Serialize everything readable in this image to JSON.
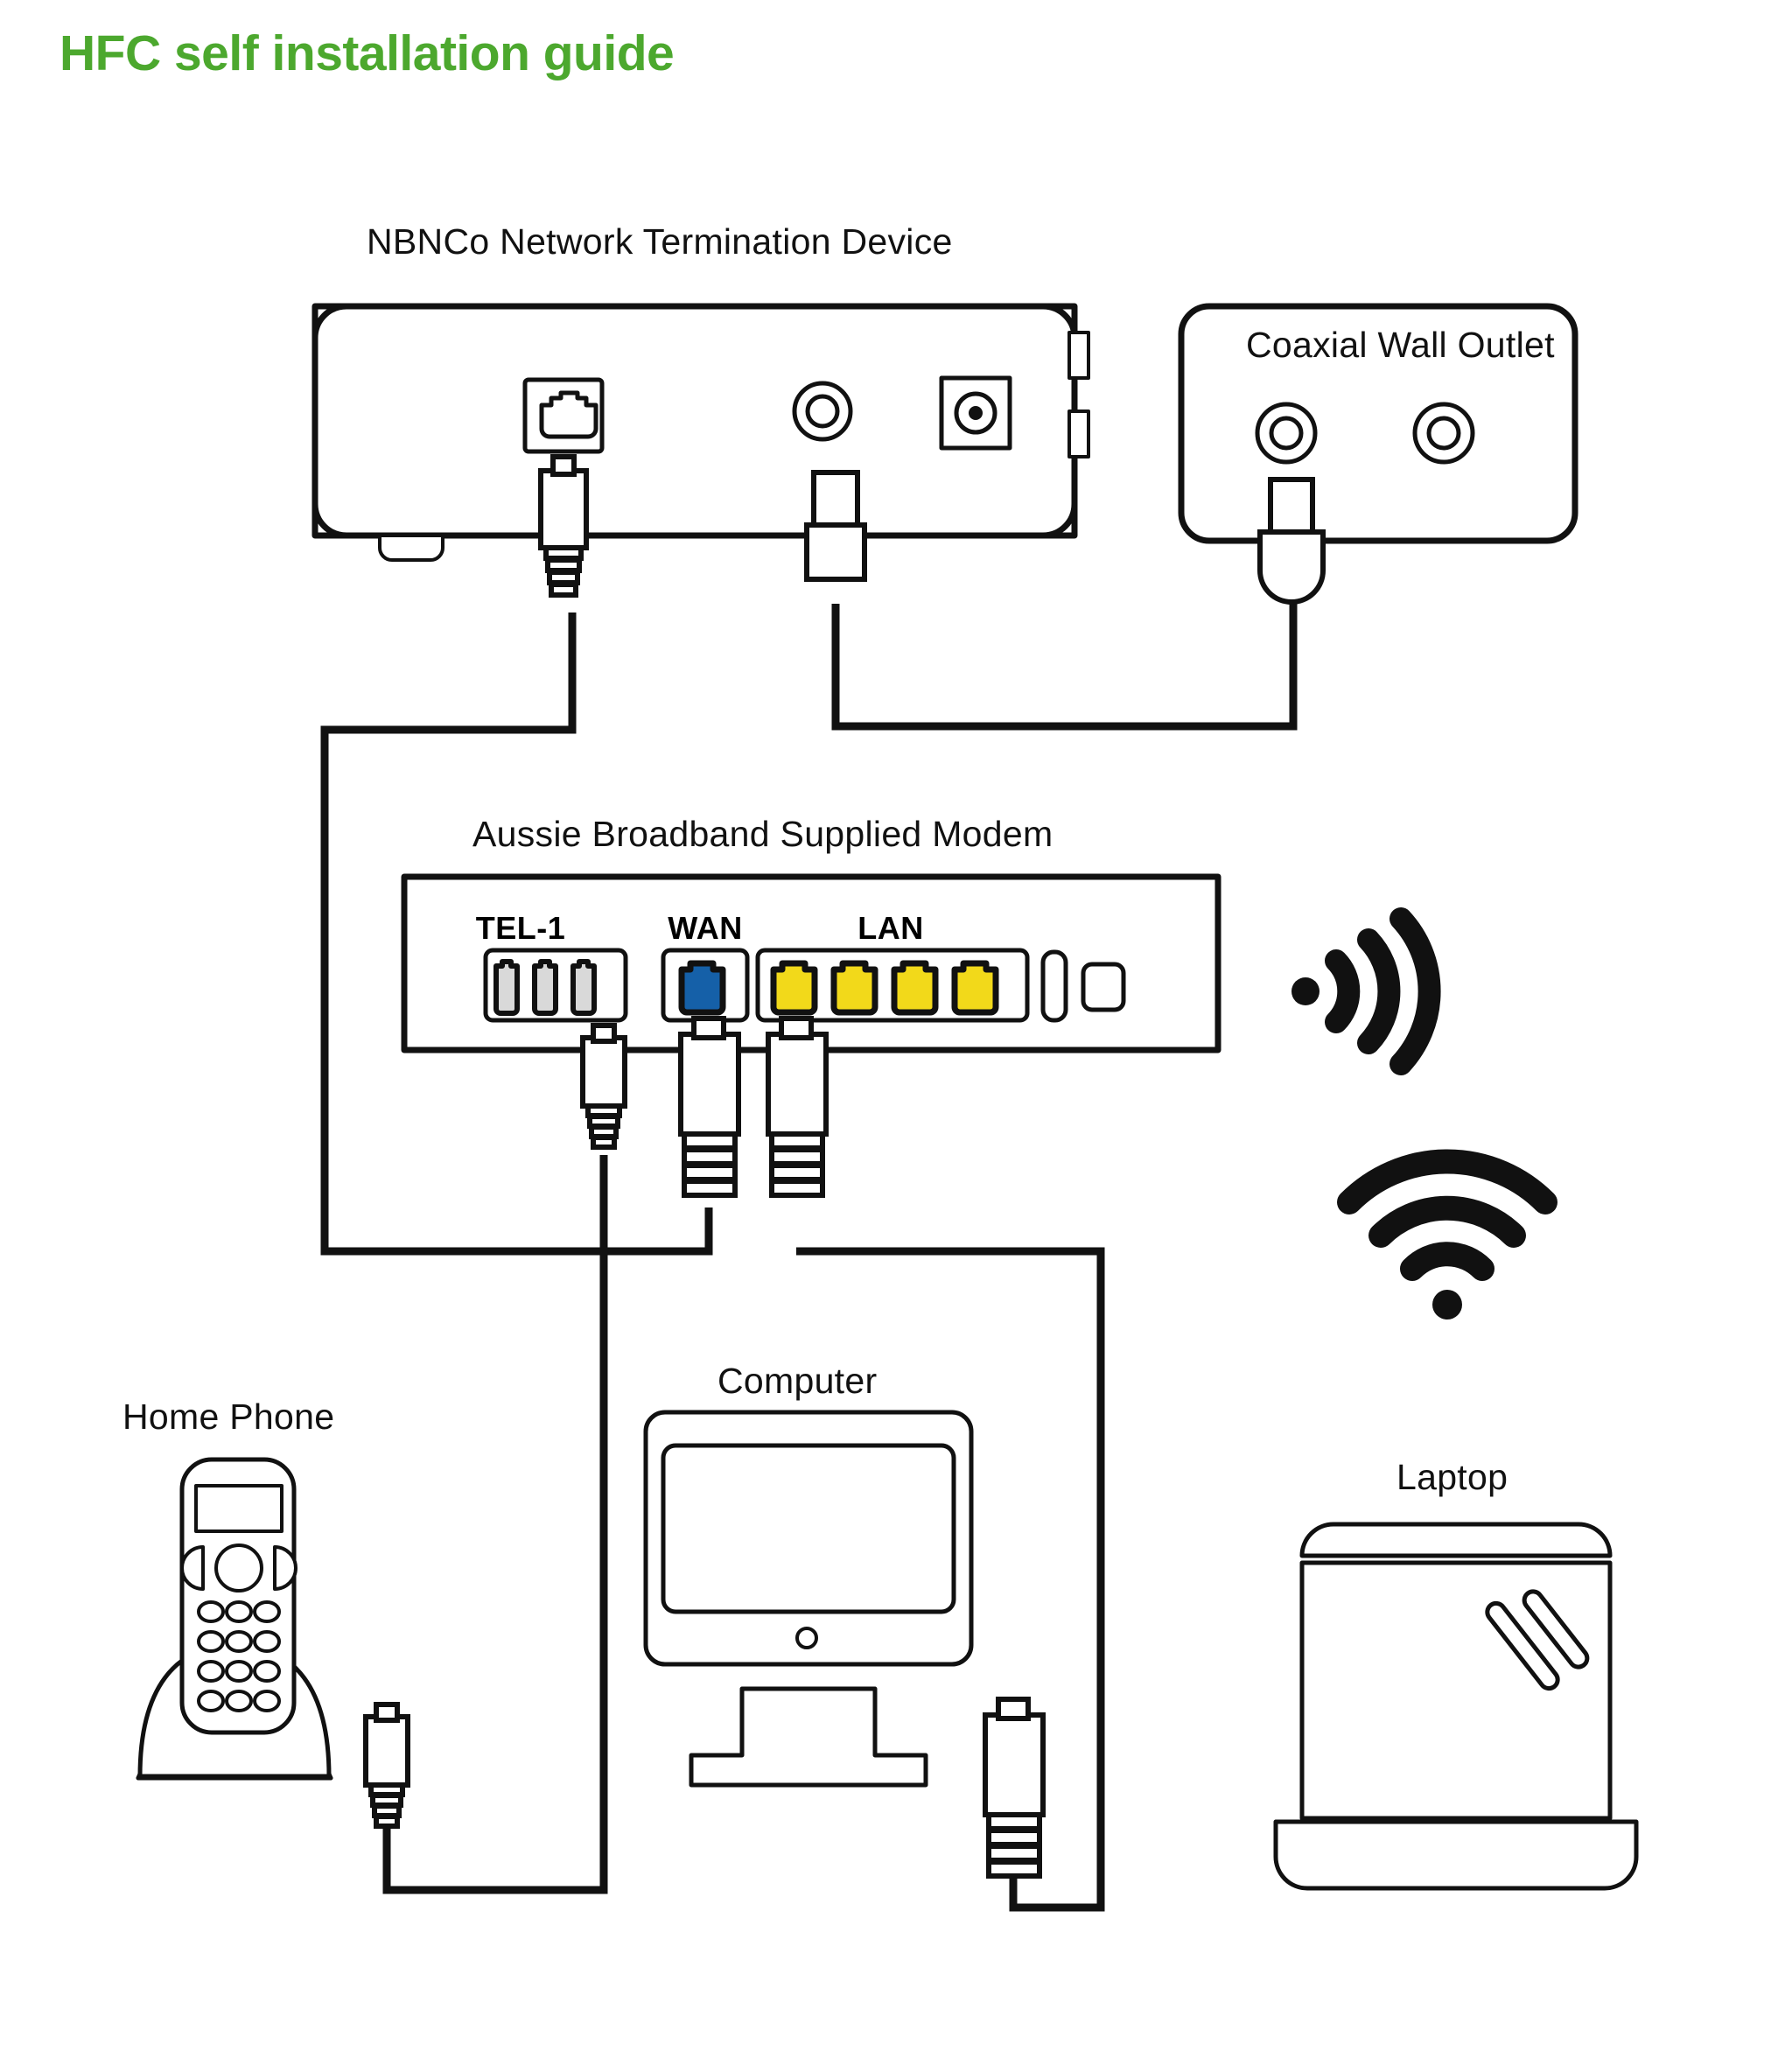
{
  "page": {
    "title": "HFC self installation guide",
    "title_color": "#4CA82E",
    "background": "#FFFFFF",
    "line_color": "#111111"
  },
  "devices": {
    "ntd": {
      "label": "NBNCo Network Termination Device",
      "ports": [
        {
          "name": "rj45-port",
          "type": "rj45"
        },
        {
          "name": "coax-port",
          "type": "coax"
        },
        {
          "name": "power-port",
          "type": "power"
        }
      ]
    },
    "wall_outlet": {
      "label": "Coaxial Wall Outlet",
      "ports": [
        {
          "name": "coax-socket-left",
          "type": "coax"
        },
        {
          "name": "coax-socket-right",
          "type": "coax"
        }
      ]
    },
    "modem": {
      "label": "Aussie Broadband Supplied Modem",
      "port_groups": [
        {
          "label": "TEL-1",
          "count": 3,
          "color": "#D9D9D9"
        },
        {
          "label": "WAN",
          "count": 1,
          "color": "#1560A8"
        },
        {
          "label": "LAN",
          "count": 4,
          "color": "#F2D91A"
        }
      ]
    },
    "home_phone": {
      "label": "Home Phone"
    },
    "computer": {
      "label": "Computer"
    },
    "laptop": {
      "label": "Laptop"
    }
  },
  "icons": [
    {
      "name": "wifi-signal-right-icon",
      "glyph": "wifi-arc-right"
    },
    {
      "name": "wifi-signal-up-icon",
      "glyph": "wifi-arc-up"
    }
  ],
  "colors": {
    "green_title": "#4CA82E",
    "wan_blue": "#1560A8",
    "lan_yellow": "#F2D91A",
    "tel_grey": "#D9D9D9",
    "stroke": "#111111"
  }
}
